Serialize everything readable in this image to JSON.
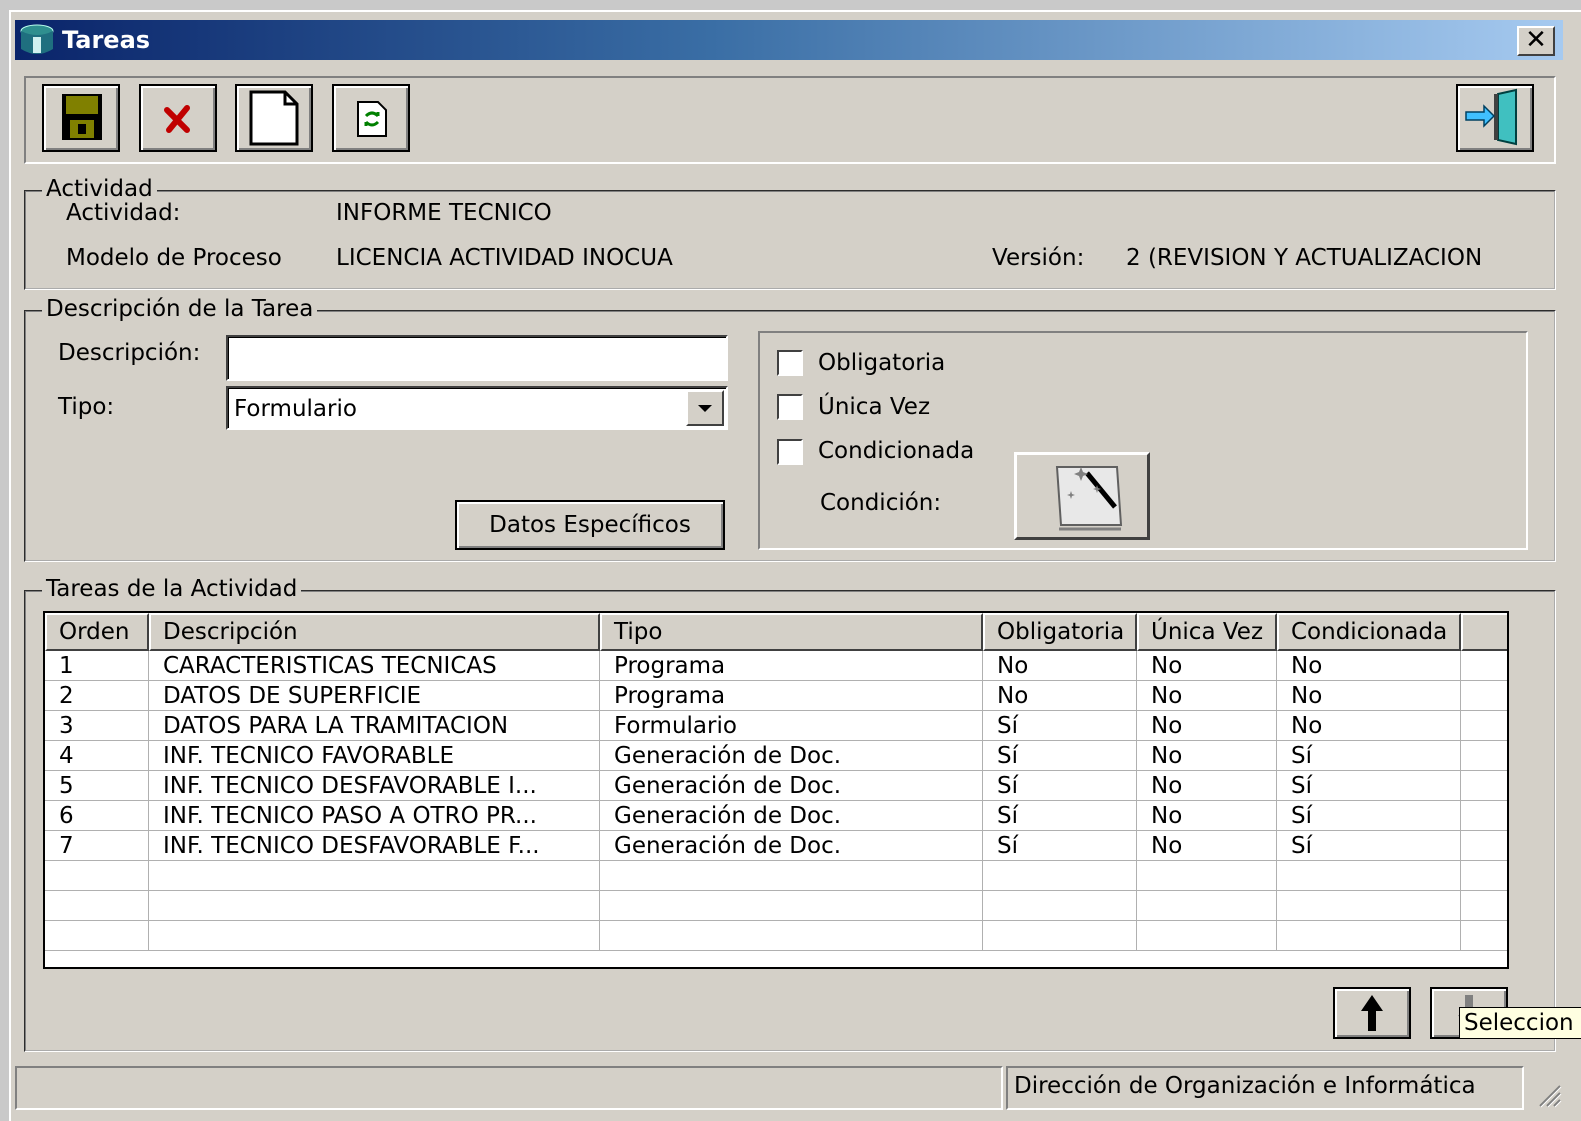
{
  "window": {
    "title": "Tareas",
    "close_label": "✕"
  },
  "toolbar": {
    "save": "save-icon",
    "delete": "delete-icon",
    "new": "new-document-icon",
    "refresh": "refresh-icon",
    "exit": "exit-door-icon"
  },
  "actividad": {
    "legend": "Actividad",
    "actividad_label": "Actividad:",
    "actividad_value": "INFORME TECNICO",
    "modelo_label": "Modelo de Proceso",
    "modelo_value": "LICENCIA ACTIVIDAD INOCUA",
    "version_label": "Versión:",
    "version_value": "2 (REVISION  Y ACTUALIZACION"
  },
  "descripcion": {
    "legend": "Descripción de la Tarea",
    "descripcion_label": "Descripción:",
    "descripcion_value": "",
    "tipo_label": "Tipo:",
    "tipo_value": "Formulario",
    "datos_btn": "Datos Específicos",
    "obligatoria": "Obligatoria",
    "unica_vez": "Única Vez",
    "condicionada": "Condicionada",
    "condicion_label": "Condición:"
  },
  "tareas": {
    "legend": "Tareas de la Actividad",
    "columns": [
      "Orden",
      "Descripción",
      "Tipo",
      "Obligatoria",
      "Única Vez",
      "Condicionada"
    ],
    "rows": [
      [
        "1",
        "CARACTERISTICAS TECNICAS",
        "Programa",
        "No",
        "No",
        "No"
      ],
      [
        "2",
        "DATOS DE SUPERFICIE",
        "Programa",
        "No",
        "No",
        "No"
      ],
      [
        "3",
        "DATOS PARA LA TRAMITACION",
        "Formulario",
        "Sí",
        "No",
        "No"
      ],
      [
        "4",
        "INF. TECNICO FAVORABLE",
        "Generación de Doc.",
        "Sí",
        "No",
        "Sí"
      ],
      [
        "5",
        "INF. TECNICO DESFAVORABLE I...",
        "Generación de Doc.",
        "Sí",
        "No",
        "Sí"
      ],
      [
        "6",
        "INF. TECNICO PASO A OTRO PR...",
        "Generación de Doc.",
        "Sí",
        "No",
        "Sí"
      ],
      [
        "7",
        "INF. TECNICO DESFAVORABLE F...",
        "Generación de Doc.",
        "Sí",
        "No",
        "Sí"
      ]
    ],
    "tooltip": "Seleccion"
  },
  "status": {
    "left": "",
    "right": "Dirección de Organización e Informática"
  }
}
